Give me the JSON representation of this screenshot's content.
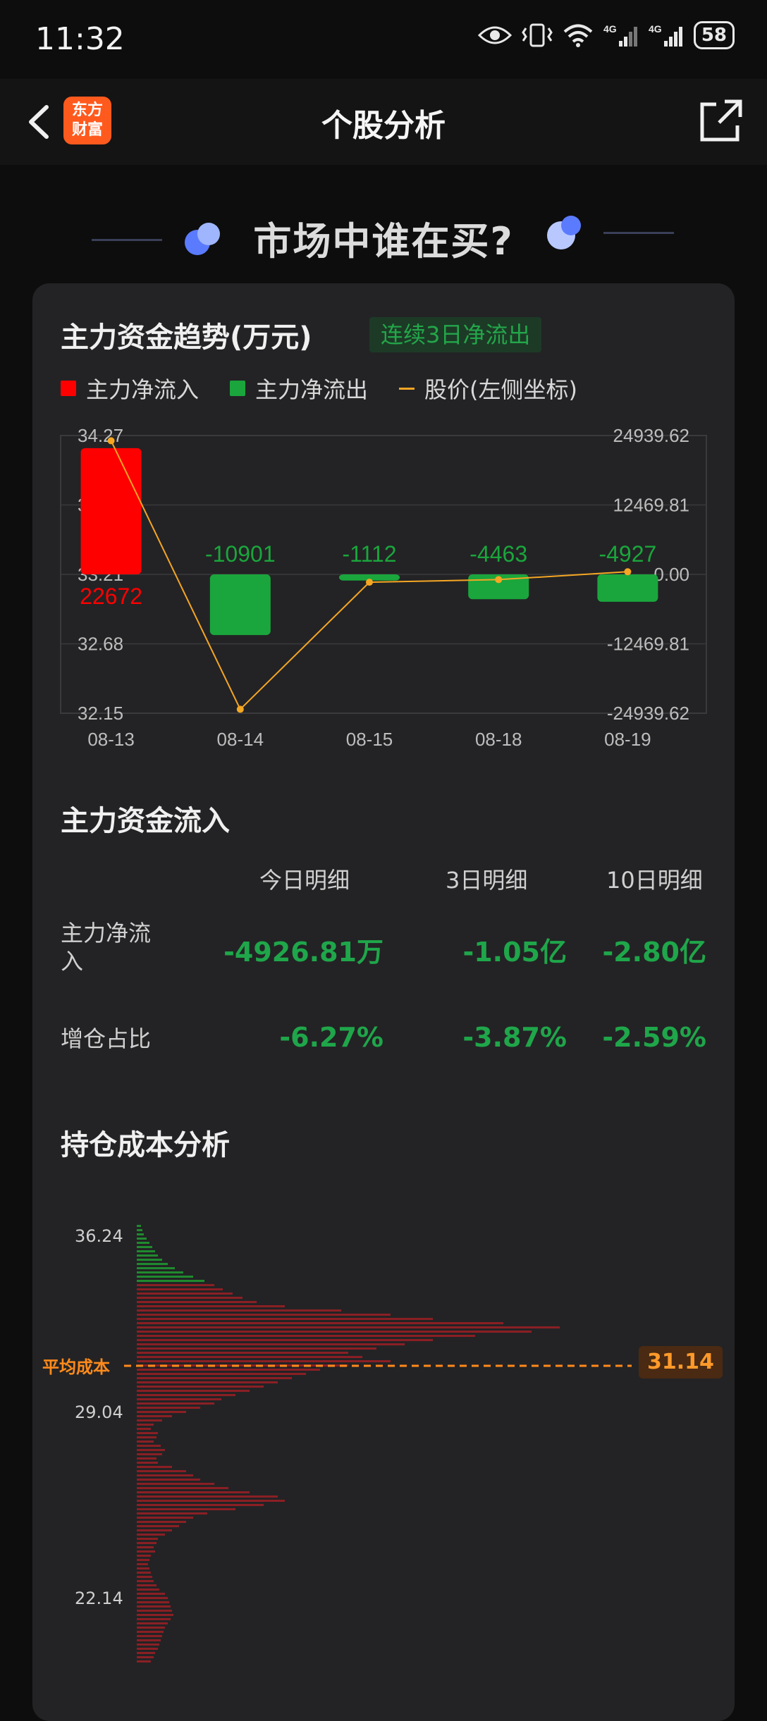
{
  "status_bar": {
    "time": "11:32",
    "battery": "58"
  },
  "nav": {
    "title": "个股分析",
    "logo_line1": "东方",
    "logo_line2": "财富"
  },
  "hero": {
    "title": "市场中谁在买?"
  },
  "trend": {
    "title": "主力资金趋势(万元)",
    "tag": "连续3日净流出",
    "legend": [
      "主力净流入",
      "主力净流出",
      "股价(左侧坐标)"
    ]
  },
  "colors": {
    "inflow": "#ff0000",
    "outflow": "#1aa63c",
    "price": "#f5a623",
    "avg": "#ff8a1a"
  },
  "chart_data": {
    "type": "bar",
    "categories": [
      "08-13",
      "08-14",
      "08-15",
      "08-18",
      "08-19"
    ],
    "series": [
      {
        "name": "主力净流入",
        "values": [
          22672,
          -10901,
          -1112,
          -4463,
          -4927
        ]
      },
      {
        "name": "股价(左侧坐标)",
        "values": [
          34.23,
          32.18,
          33.15,
          33.17,
          33.23
        ]
      }
    ],
    "bar_labels": [
      "22672",
      "-10901",
      "-1112",
      "-4463",
      "-4927"
    ],
    "left_axis": {
      "ticks": [
        "34.27",
        "33.74",
        "33.21",
        "32.68",
        "32.15"
      ],
      "ylim": [
        32.15,
        34.27
      ]
    },
    "right_axis": {
      "ticks": [
        "24939.62",
        "12469.81",
        "0.00",
        "-12469.81",
        "-24939.62"
      ],
      "ylim": [
        -24939.62,
        24939.62
      ]
    }
  },
  "flow": {
    "title": "主力资金流入",
    "headers": [
      "今日明细",
      "3日明细",
      "10日明细"
    ],
    "rows": [
      {
        "label": "主力净流入",
        "values": [
          "-4926.81万",
          "-1.05亿",
          "-2.80亿"
        ]
      },
      {
        "label": "增仓占比",
        "values": [
          "-6.27%",
          "-3.87%",
          "-2.59%"
        ]
      }
    ]
  },
  "cost": {
    "title": "持仓成本分析",
    "price_labels": [
      "36.24",
      "29.04",
      "22.14"
    ],
    "avg_label": "平均成本",
    "avg_value": "31.14"
  }
}
